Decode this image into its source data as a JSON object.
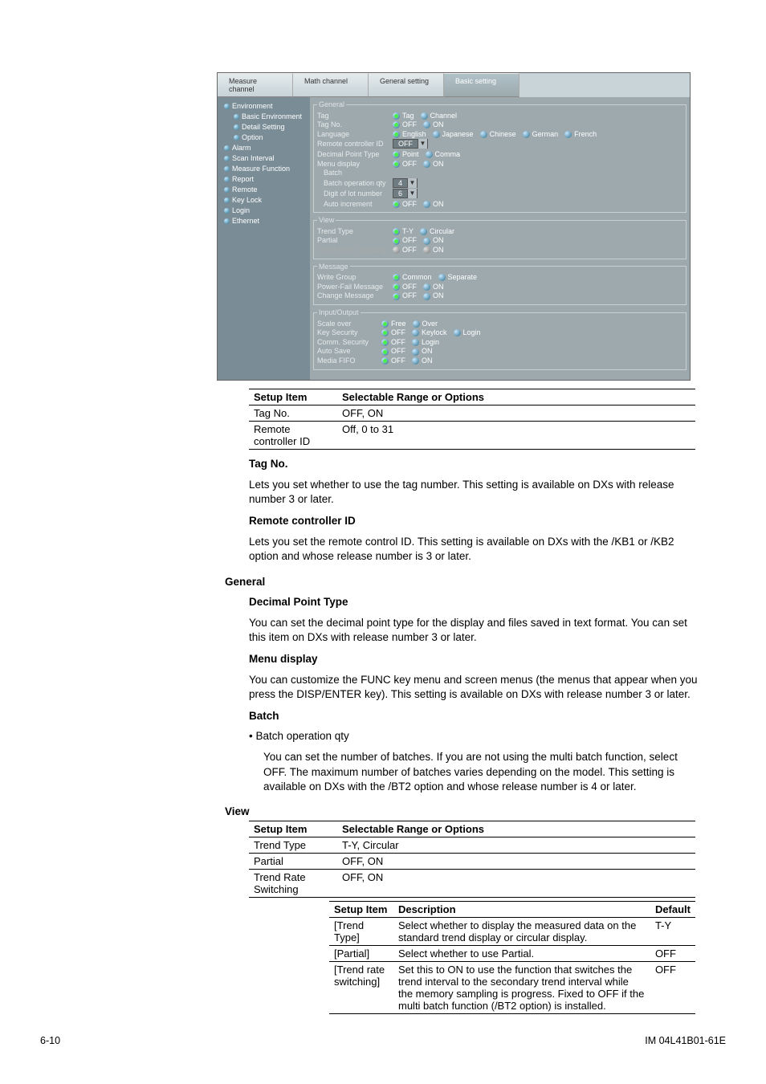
{
  "tabs": [
    "Measure channel",
    "Math channel",
    "General setting",
    "Basic setting"
  ],
  "tree": [
    {
      "t": "Environment",
      "c": false
    },
    {
      "t": "Basic Environment",
      "c": true
    },
    {
      "t": "Detail Setting",
      "c": true
    },
    {
      "t": "Option",
      "c": true
    },
    {
      "t": "Alarm",
      "c": false
    },
    {
      "t": "Scan Interval",
      "c": false
    },
    {
      "t": "Measure Function",
      "c": false
    },
    {
      "t": "Report",
      "c": false
    },
    {
      "t": "Remote",
      "c": false
    },
    {
      "t": "Key Lock",
      "c": false
    },
    {
      "t": "Login",
      "c": false
    },
    {
      "t": "Ethernet",
      "c": false
    }
  ],
  "groups": {
    "general": {
      "legend": "General",
      "rows": [
        {
          "lbl": "Tag",
          "opts": [
            "Tag",
            "Channel"
          ],
          "on": 0
        },
        {
          "lbl": "Tag No.",
          "opts": [
            "OFF",
            "ON"
          ],
          "on": 0
        },
        {
          "lbl": "Language",
          "opts": [
            "English",
            "Japanese",
            "Chinese",
            "German",
            "French"
          ],
          "on": 0
        },
        {
          "lbl": "Remote controller ID",
          "sel": "OFF"
        },
        {
          "lbl": "Decimal Point Type",
          "opts": [
            "Point",
            "Comma"
          ],
          "on": 0
        },
        {
          "lbl": "Menu display",
          "opts": [
            "OFF",
            "ON"
          ],
          "on": 0
        },
        {
          "lbl": "Batch",
          "head": true
        },
        {
          "lbl": "Batch operation qty",
          "sel": "4"
        },
        {
          "lbl": "Digit of lot number",
          "sel": "6"
        },
        {
          "lbl": "Auto increment",
          "opts": [
            "OFF",
            "ON"
          ],
          "on": 0
        }
      ]
    },
    "view": {
      "legend": "View",
      "rows": [
        {
          "lbl": "Trend Type",
          "opts": [
            "T-Y",
            "Circular"
          ],
          "on": 0
        },
        {
          "lbl": "Partial",
          "opts": [
            "OFF",
            "ON"
          ],
          "on": 0
        },
        {
          "lbl": "Trend Rate Switching",
          "opts": [
            "OFF",
            "ON"
          ],
          "on": 0,
          "disabled": true
        }
      ]
    },
    "message": {
      "legend": "Message",
      "rows": [
        {
          "lbl": "Write Group",
          "opts": [
            "Common",
            "Separate"
          ],
          "on": 0
        },
        {
          "lbl": "Power-Fail Message",
          "opts": [
            "OFF",
            "ON"
          ],
          "on": 0
        },
        {
          "lbl": "Change Message",
          "opts": [
            "OFF",
            "ON"
          ],
          "on": 0
        }
      ]
    },
    "inout": {
      "legend": "Input/Output",
      "rows": [
        {
          "lbl": "Scale over",
          "opts": [
            "Free",
            "Over"
          ],
          "on": 0
        },
        {
          "lbl": "Key Security",
          "opts": [
            "OFF",
            "Keylock",
            "Login"
          ],
          "on": 0
        },
        {
          "lbl": "Comm. Security",
          "opts": [
            "OFF",
            "Login"
          ],
          "on": 0
        },
        {
          "lbl": "Auto Save",
          "opts": [
            "OFF",
            "ON"
          ],
          "on": 0
        },
        {
          "lbl": "Media FIFO",
          "opts": [
            "OFF",
            "ON"
          ],
          "on": 0
        }
      ]
    }
  },
  "body1": {
    "table1": {
      "head": [
        "Setup Item",
        "Selectable Range or Options"
      ],
      "rows": [
        [
          "Tag No.",
          "OFF, ON"
        ],
        [
          "Remote controller ID",
          "Off, 0 to 31"
        ]
      ]
    },
    "tagno_heading": "Tag No.",
    "tagno_text": "Lets you set whether to use the tag number. This setting is available on DXs with release number 3 or later.",
    "remote_heading": "Remote controller ID",
    "remote_text": "Lets you set the remote control ID. This setting is available on DXs with the /KB1 or /KB2 option and whose release number is 3 or later.",
    "section_general": "General",
    "dpt_heading": "Decimal Point Type",
    "dpt_text": "You can set the decimal point type for the display and files saved in text format. You can set this item on DXs with release number 3 or later.",
    "menu_heading": "Menu display",
    "menu_text": "You can customize the FUNC key menu and screen menus (the menus that appear when you press the DISP/ENTER key). This setting is available on DXs with release number 3 or later.",
    "batch_heading": "Batch",
    "batch_qty_label": "• Batch operation qty",
    "batch_qty_text": "You can set the number of batches. If you are not using the multi batch function, select OFF. The maximum number of batches varies depending on the model. This setting is available on DXs with the /BT2 option and whose release number is 4 or later.",
    "section_view": "View",
    "table2": {
      "head": [
        "Setup Item",
        "Selectable Range or Options"
      ],
      "rows": [
        [
          "Trend Type",
          "T-Y, Circular"
        ],
        [
          "Partial",
          "OFF, ON"
        ],
        [
          "Trend Rate Switching",
          "OFF, ON"
        ]
      ]
    },
    "table3": {
      "head": [
        "Setup Item",
        "Description",
        "Default"
      ],
      "rows": [
        [
          "[Trend Type]",
          "Select whether to display the measured data on the standard trend display or circular display.",
          "T-Y"
        ],
        [
          "[Partial]",
          "Select whether to use Partial.",
          "OFF"
        ],
        [
          "[Trend rate switching]",
          "Set this to ON to use the function that switches the trend interval to the secondary trend interval while the memory sampling is progress. Fixed to OFF if the multi batch function (/BT2 option) is installed.",
          "OFF"
        ]
      ]
    }
  },
  "footer": {
    "left": "6-10",
    "right": "IM 04L41B01-61E"
  }
}
